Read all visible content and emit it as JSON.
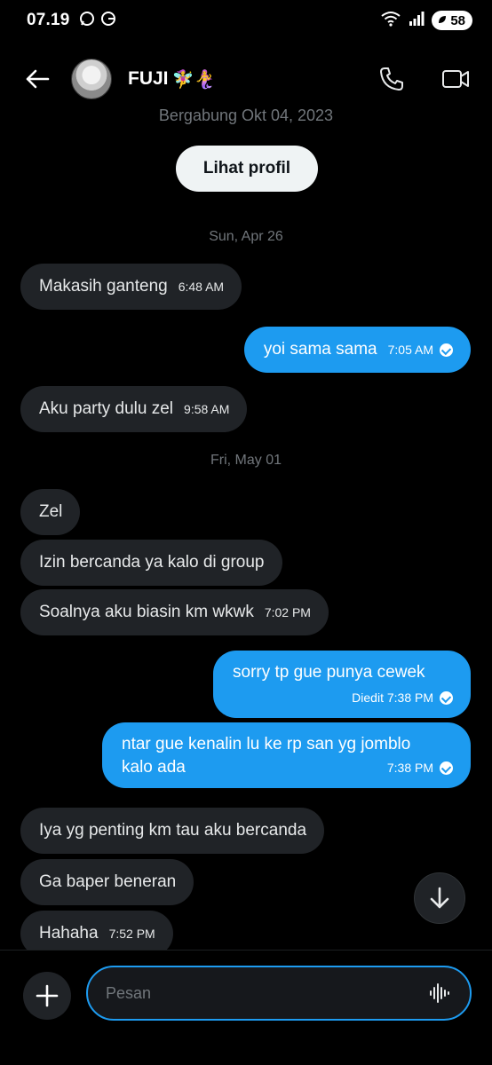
{
  "status_bar": {
    "time": "07.19",
    "battery": "58"
  },
  "header": {
    "contact_name": "FUJI",
    "name_emojis": "🧚‍♀️🧜‍♀️"
  },
  "chat": {
    "joined_text": "Bergabung Okt 04, 2023",
    "profile_button": "Lihat profil",
    "date_separators": [
      "Sun, Apr 26",
      "Fri, May 01"
    ],
    "messages": [
      {
        "side": "received",
        "text": "Makasih ganteng",
        "time": "6:48 AM"
      },
      {
        "side": "sent",
        "text": "yoi sama sama",
        "time": "7:05 AM"
      },
      {
        "side": "received",
        "text": "Aku party dulu zel",
        "time": "9:58 AM"
      },
      {
        "side": "received",
        "text": "Zel",
        "time": ""
      },
      {
        "side": "received",
        "text": "Izin bercanda ya kalo di group",
        "time": ""
      },
      {
        "side": "received",
        "text": "Soalnya aku biasin km wkwk",
        "time": "7:02 PM"
      },
      {
        "side": "sent",
        "text": "sorry tp gue punya cewek",
        "time": "Diedit 7:38 PM"
      },
      {
        "side": "sent",
        "text_line1": "ntar gue kenalin lu ke rp san yg jomblo",
        "text_line2": "kalo ada",
        "time": "7:38 PM"
      },
      {
        "side": "received",
        "text": "Iya yg penting km tau aku bercanda",
        "time": ""
      },
      {
        "side": "received",
        "text": "Ga baper beneran",
        "time": ""
      },
      {
        "side": "received",
        "text": "Hahaha",
        "time": "7:52 PM"
      }
    ]
  },
  "composer": {
    "placeholder": "Pesan"
  },
  "colors": {
    "accent": "#1d9bf0",
    "received_bubble": "#202327",
    "background": "#000000"
  }
}
